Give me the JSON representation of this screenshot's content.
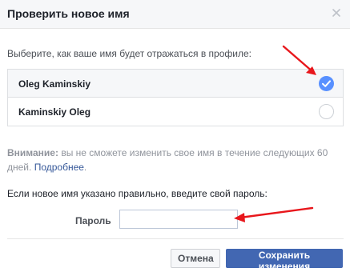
{
  "dialog": {
    "title": "Проверить новое имя",
    "close_icon": "close-icon"
  },
  "name_choice": {
    "prompt": "Выберите, как ваше имя будет отражаться в профиле:",
    "options": [
      {
        "label": "Oleg Kaminskiy",
        "selected": true
      },
      {
        "label": "Kaminskiy Oleg",
        "selected": false
      }
    ]
  },
  "warning": {
    "bold": "Внимание:",
    "text": " вы не сможете изменить свое имя в течение следующих 60 дней. ",
    "link": "Подробнее",
    "end": "."
  },
  "password": {
    "hint": "Если новое имя указано правильно, введите свой пароль:",
    "label": "Пароль",
    "value": "",
    "placeholder": ""
  },
  "buttons": {
    "cancel_label": "Отмена",
    "save_label": "Сохранить изменения"
  },
  "colors": {
    "accent": "#4267b2",
    "radio_checked": "#5890ff",
    "annotation_arrow": "#e8171c"
  }
}
